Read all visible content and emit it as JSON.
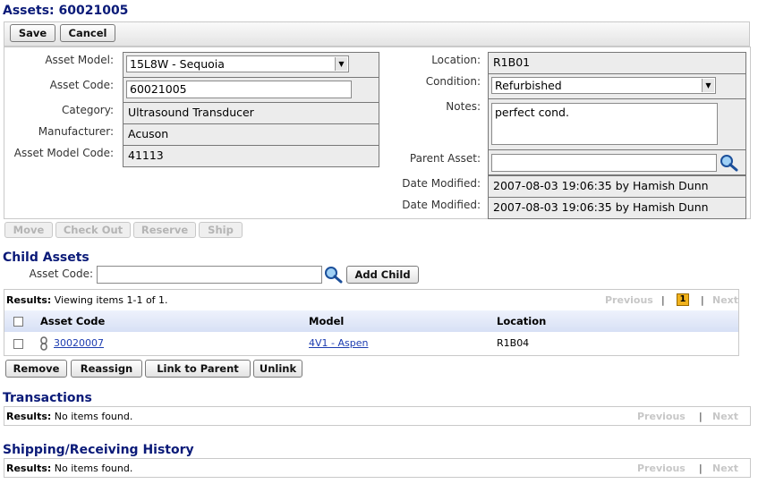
{
  "page": {
    "title": "Assets: 60021005"
  },
  "toolbar": {
    "save_label": "Save",
    "cancel_label": "Cancel"
  },
  "left_fields": {
    "asset_model": {
      "label": "Asset Model:",
      "value": "15L8W - Sequoia"
    },
    "asset_code": {
      "label": "Asset Code:",
      "value": "60021005"
    },
    "category": {
      "label": "Category:",
      "value": "Ultrasound Transducer"
    },
    "manufacturer": {
      "label": "Manufacturer:",
      "value": "Acuson"
    },
    "asset_model_code": {
      "label": "Asset Model Code:",
      "value": "41113"
    }
  },
  "right_fields": {
    "location": {
      "label": "Location:",
      "value": "R1B01"
    },
    "condition": {
      "label": "Condition:",
      "value": "Refurbished"
    },
    "notes": {
      "label": "Notes:",
      "value": "perfect cond."
    },
    "parent_asset": {
      "label": "Parent Asset:",
      "value": ""
    },
    "date_modified_1": {
      "label": "Date Modified:",
      "value": "2007-08-03 19:06:35 by Hamish Dunn"
    },
    "date_modified_2": {
      "label": "Date Modified:",
      "value": "2007-08-03 19:06:35 by Hamish Dunn"
    }
  },
  "actions": {
    "move": "Move",
    "check_out": "Check Out",
    "reserve": "Reserve",
    "ship": "Ship"
  },
  "child_assets": {
    "title": "Child Assets",
    "asset_code_label": "Asset Code:",
    "asset_code_value": "",
    "add_child_label": "Add Child",
    "results_label": "Results:",
    "results_text": "Viewing items 1-1 of 1.",
    "pager": {
      "previous": "Previous",
      "sep": "|",
      "page": "1",
      "next": "Next"
    },
    "columns": [
      "Asset Code",
      "Model",
      "Location"
    ],
    "rows": [
      {
        "asset_code": "30020007",
        "model": "4V1 - Aspen",
        "location": "R1B04"
      }
    ],
    "buttons": {
      "remove": "Remove",
      "reassign": "Reassign",
      "link_to_parent": "Link to Parent",
      "unlink": "Unlink"
    }
  },
  "transactions": {
    "title": "Transactions",
    "results_label": "Results:",
    "results_text": "No items found.",
    "pager": {
      "previous": "Previous",
      "sep": "|",
      "next": "Next"
    }
  },
  "shipping": {
    "title": "Shipping/Receiving History",
    "results_label": "Results:",
    "results_text": "No items found.",
    "pager": {
      "previous": "Previous",
      "sep": "|",
      "next": "Next"
    }
  },
  "colors": {
    "heading": "#0a1a78",
    "link": "#1c3cb0",
    "page_badge": "#f0b21c",
    "header_row": "#dde6f8"
  }
}
